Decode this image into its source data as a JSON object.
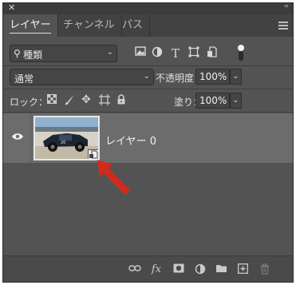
{
  "window": {
    "close_glyph": "✕",
    "collapse_glyph": "‹‹"
  },
  "tabs": [
    {
      "label": "レイヤー",
      "active": true
    },
    {
      "label": "チャンネル",
      "active": false
    },
    {
      "label": "パス",
      "active": false
    }
  ],
  "panel_menu_icon": "hamburger-menu-icon",
  "filter": {
    "kind_label": "種類",
    "filter_icons": [
      "image-filter-icon",
      "adjustment-filter-icon",
      "type-filter-icon",
      "shape-filter-icon",
      "smart-object-filter-icon"
    ],
    "toggle_icon": "filter-toggle-icon"
  },
  "blend": {
    "mode": "通常",
    "opacity_label": "不透明度：",
    "opacity_value": "100%"
  },
  "lock": {
    "label": "ロック：",
    "icons": [
      "lock-transparent-pixels-icon",
      "lock-image-pixels-icon",
      "lock-position-icon",
      "lock-artboard-icon",
      "lock-all-icon"
    ],
    "fill_label": "塗り：",
    "fill_value": "100%"
  },
  "layer": {
    "name": "レイヤー 0",
    "visible": true,
    "is_smart_object": true
  },
  "footer_icons": [
    "link-layers-icon",
    "fx-icon",
    "add-mask-icon",
    "new-fill-adjustment-icon",
    "new-group-icon",
    "new-layer-icon",
    "delete-layer-icon"
  ],
  "colors": {
    "panel_bg": "#535353",
    "selected_row": "#6c6c6c",
    "annotation_arrow": "#d42a1e"
  }
}
